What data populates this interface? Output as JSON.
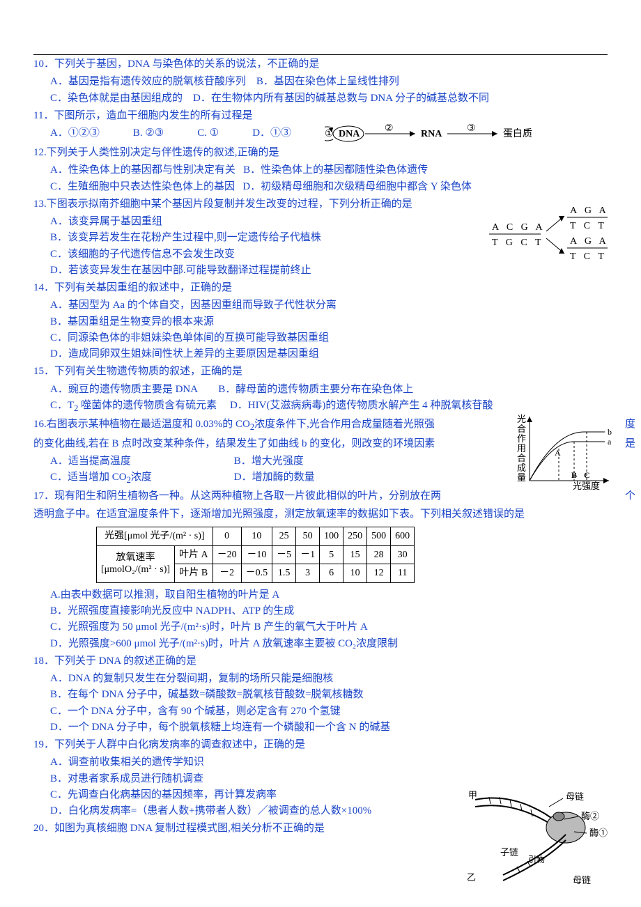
{
  "q10": {
    "stem": "10．下列关于基因，DNA 与染色体的关系的说法，不正确的是",
    "optA": "A．基因是指有遗传效应的脱氧核苷酸序列",
    "optB": "B．基因在染色体上呈线性排列",
    "optC": "C．染色体就是由基因组成的",
    "optD": "D．在生物体内所有基因的碱基总数与 DNA 分子的碱基总数不同"
  },
  "q11": {
    "stem": "11．下图所示，造血干细胞内发生的所有过程是",
    "optA": "A．①②③",
    "optB": "B. ②③",
    "optC": "C. ①",
    "optD": "D．①③",
    "diagram": {
      "n1": "DNA",
      "n2": "RNA",
      "n3": "蛋白质",
      "a1": "①",
      "a2": "②",
      "a3": "③"
    }
  },
  "q12": {
    "stem": "12.下列关于人类性别决定与伴性遗传的叙述,正确的是",
    "optA": "A．性染色体上的基因都与性别决定有关",
    "optB": "B．性染色体上的基因都随性染色体遗传",
    "optC": "C．生殖细胞中只表达性染色体上的基因",
    "optD": "D．初级精母细胞和次级精母细胞中都含 Y 染色体"
  },
  "q13": {
    "stem": "13.下图表示拟南芥细胞中某个基因片段复制并发生改变的过程，下列分析正确的是",
    "optA": "A．该变异属于基因重组",
    "optB": "B．该变异若发生在花粉产生过程中,则一定遗传给子代植株",
    "optC": "C．该细胞的子代遗传信息不会发生改变",
    "optD": "D．若该变异发生在基因中部.可能导致翻译过程提前终止",
    "diagram": {
      "top1": "A C G A",
      "bot1": "T G C T",
      "top2a": "A G A",
      "bot2a": "T C T",
      "top2b": "A G A",
      "bot2b": "T C T"
    }
  },
  "q14": {
    "stem": "14．下列有关基因重组的叙述中，正确的是",
    "optA": "A．基因型为 Aa 的个体自交，因基因重组而导致子代性状分离",
    "optB": "B．基因重组是生物变异的根本来源",
    "optC": "C．同源染色体的非姐妹染色单体间的互换可能导致基因重组",
    "optD": "D．造成同卵双生姐妹间性状上差异的主要原因是基因重组"
  },
  "q15": {
    "stem": "15．下列有关生物遗传物质的叙述，正确的是",
    "optA": "A．豌豆的遗传物质主要是 DNA",
    "optB": "B．酵母菌的遗传物质主要分布在染色体上",
    "optC_pre": "C．T",
    "optC_sub": "2",
    "optC_post": " 噬菌体的遗传物质含有硫元素",
    "optD": "D．HIV(艾滋病病毒)的遗传物质水解产生 4 种脱氧核苷酸"
  },
  "q16": {
    "stem_a": "16.右图表示某种植物在最适温度和 0.03%的 CO",
    "stem_a_sub": "2",
    "stem_a_post": "浓度条件下,光合作用合成量随着光照强",
    "tail_a": "度",
    "stem_b": "的变化曲线,若在 B 点时改变某种条件，结果发生了如曲线 b 的变化，则改变的环境因素",
    "tail_b": "是",
    "optA": "A．适当提高温度",
    "optB": "B．增大光强度",
    "optC_pre": "C．适当增加 CO",
    "optC_sub": "2",
    "optC_post": "浓度",
    "optD": "D．增加酶的数量",
    "axis_y": "光合作用合成量",
    "axis_x": "光强度",
    "label_a": "a",
    "label_b": "b",
    "pt_A": "A",
    "pt_B": "B",
    "pt_C": "C"
  },
  "q17": {
    "stem_a": "17．现有阳生和阴生植物各一种。从这两种植物上各取一片彼此相似的叶片，分别放在两",
    "tail_a": "个",
    "stem_b": "透明盒子中。在适宜温度条件下，逐渐增加光照强度，测定放氧速率的数据如下表。下列相关叙述错误的是",
    "optA": "A.由表中数据可以推测，取自阳生植物的叶片是 A",
    "optB": "B．光照强度直接影响光反应中 NADPH、ATP 的生成",
    "optC": "C．光照强度为 50 μmol 光子/(m²·s)时，叶片 B 产生的氧气大于叶片 A",
    "optD": "D．光照强度>600 μmol 光子/(m²·s)时，叶片 A 放氧速率主要被 CO₂浓度限制"
  },
  "table": {
    "h1": "光强[μmol 光子/(m² · s)]",
    "h2": "放氧速率",
    "h3": "[μmolO₂/(m² · s)]",
    "leafA": "叶片 A",
    "leafB": "叶片 B"
  },
  "chart_data": {
    "type": "table",
    "columns": [
      "光强[μmol 光子/(m²·s)]",
      0,
      10,
      25,
      50,
      100,
      250,
      500,
      600
    ],
    "series": [
      {
        "name": "叶片 A",
        "values": [
          -20,
          -10,
          -5,
          -1,
          5,
          15,
          28,
          30
        ]
      },
      {
        "name": "叶片 B",
        "values": [
          -2,
          -0.5,
          1.5,
          3,
          6,
          10,
          12,
          11
        ]
      }
    ]
  },
  "q18": {
    "stem": "18．下列关于 DNA 的叙述正确的是",
    "optA": "A．DNA 的复制只发生在分裂间期，复制的场所只能是细胞核",
    "optB": "B．在每个 DNA 分子中，碱基数=磷酸数=脱氧核苷酸数=脱氧核糖数",
    "optC": "C．一个 DNA 分子中，含有 90 个碱基，则必定含有 270 个氢键",
    "optD": "D．一个 DNA 分子中，每个脱氧核糖上均连有一个磷酸和一个含 N 的碱基"
  },
  "q19": {
    "stem": "19．下列关于人群中白化病发病率的调查叙述中，正确的是",
    "optA": "A．调查前收集相关的遗传学知识",
    "optB": "B．对患者家系成员进行随机调查",
    "optC": "C．先调查白化病基因的基因频率，再计算发病率",
    "optD": "D．白化病发病率=（患者人数+携带者人数）／被调查的总人数×100%"
  },
  "q20": {
    "stem": "20．如图为真核细胞 DNA 复制过程模式图,相关分析不正确的是",
    "lab_jia": "甲",
    "lab_yi": "乙",
    "lab_mu": "母链",
    "lab_mei1": "酶①",
    "lab_mei2": "酶②",
    "lab_zi": "子链",
    "lab_yin": "引物"
  }
}
